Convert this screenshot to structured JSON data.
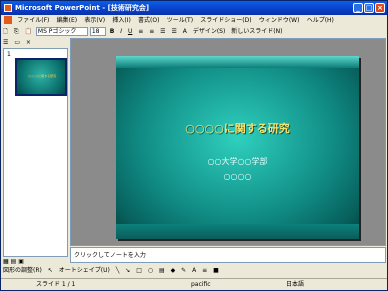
{
  "window": {
    "title": "Microsoft PowerPoint - [技術研究会]"
  },
  "menu": [
    "ファイル(F)",
    "編集(E)",
    "表示(V)",
    "挿入(I)",
    "書式(O)",
    "ツール(T)",
    "スライドショー(D)",
    "ウィンドウ(W)",
    "ヘルプ(H)"
  ],
  "toolbar": {
    "font_name": "MS Pゴシック",
    "font_size": "18",
    "design_label": "デザイン(S)",
    "new_slide_label": "新しいスライド(N)"
  },
  "thumb": {
    "number": "1"
  },
  "slide": {
    "title": "○○○○に関する研究",
    "subtitle1": "○○大学○○学部",
    "subtitle2": "○○○○"
  },
  "notes": {
    "placeholder": "クリックしてノートを入力"
  },
  "drawing": {
    "menu_label": "図形の調整(R)",
    "autoshape_label": "オートシェイプ(U)"
  },
  "status": {
    "slide": "スライド 1 / 1",
    "design": "pacific",
    "language": "日本語"
  },
  "colors": {
    "title_bar": "#0a3fc8",
    "slide_bg": "#118d86",
    "title_text": "#f8e06a"
  }
}
